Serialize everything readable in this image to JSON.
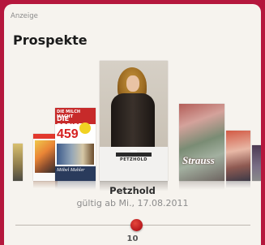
{
  "ad_label": "Anzeige",
  "title": "Prospekte",
  "covers": {
    "main_logo": "PETZHOLD",
    "left_headline_top": "DIE MILCH MACHT",
    "left_headline": "DIE PREISE",
    "left_price": "459",
    "left_footer": "Möbel Mahler",
    "right_brand": "Strauss"
  },
  "current": {
    "store": "Petzhold",
    "valid": "gültig ab Mi., 17.08.2011"
  },
  "slider": {
    "count": "10"
  },
  "colors": {
    "frame": "#b5173d",
    "knob": "#b6171c",
    "background": "#f6f3ee"
  }
}
